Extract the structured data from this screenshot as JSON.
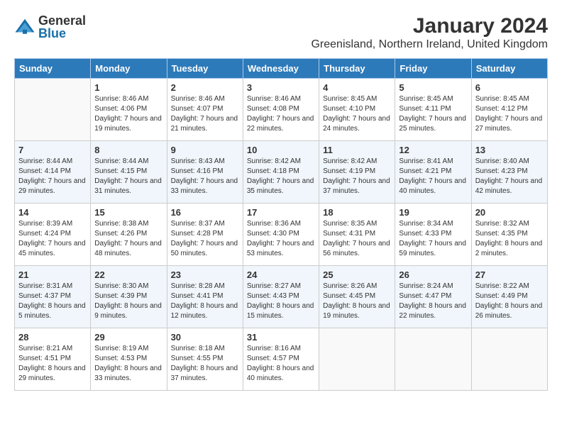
{
  "logo": {
    "text_general": "General",
    "text_blue": "Blue"
  },
  "title": "January 2024",
  "location": "Greenisland, Northern Ireland, United Kingdom",
  "days_of_week": [
    "Sunday",
    "Monday",
    "Tuesday",
    "Wednesday",
    "Thursday",
    "Friday",
    "Saturday"
  ],
  "weeks": [
    [
      {
        "day": "",
        "empty": true
      },
      {
        "day": "1",
        "sunrise": "Sunrise: 8:46 AM",
        "sunset": "Sunset: 4:06 PM",
        "daylight": "Daylight: 7 hours and 19 minutes."
      },
      {
        "day": "2",
        "sunrise": "Sunrise: 8:46 AM",
        "sunset": "Sunset: 4:07 PM",
        "daylight": "Daylight: 7 hours and 21 minutes."
      },
      {
        "day": "3",
        "sunrise": "Sunrise: 8:46 AM",
        "sunset": "Sunset: 4:08 PM",
        "daylight": "Daylight: 7 hours and 22 minutes."
      },
      {
        "day": "4",
        "sunrise": "Sunrise: 8:45 AM",
        "sunset": "Sunset: 4:10 PM",
        "daylight": "Daylight: 7 hours and 24 minutes."
      },
      {
        "day": "5",
        "sunrise": "Sunrise: 8:45 AM",
        "sunset": "Sunset: 4:11 PM",
        "daylight": "Daylight: 7 hours and 25 minutes."
      },
      {
        "day": "6",
        "sunrise": "Sunrise: 8:45 AM",
        "sunset": "Sunset: 4:12 PM",
        "daylight": "Daylight: 7 hours and 27 minutes."
      }
    ],
    [
      {
        "day": "7",
        "sunrise": "Sunrise: 8:44 AM",
        "sunset": "Sunset: 4:14 PM",
        "daylight": "Daylight: 7 hours and 29 minutes."
      },
      {
        "day": "8",
        "sunrise": "Sunrise: 8:44 AM",
        "sunset": "Sunset: 4:15 PM",
        "daylight": "Daylight: 7 hours and 31 minutes."
      },
      {
        "day": "9",
        "sunrise": "Sunrise: 8:43 AM",
        "sunset": "Sunset: 4:16 PM",
        "daylight": "Daylight: 7 hours and 33 minutes."
      },
      {
        "day": "10",
        "sunrise": "Sunrise: 8:42 AM",
        "sunset": "Sunset: 4:18 PM",
        "daylight": "Daylight: 7 hours and 35 minutes."
      },
      {
        "day": "11",
        "sunrise": "Sunrise: 8:42 AM",
        "sunset": "Sunset: 4:19 PM",
        "daylight": "Daylight: 7 hours and 37 minutes."
      },
      {
        "day": "12",
        "sunrise": "Sunrise: 8:41 AM",
        "sunset": "Sunset: 4:21 PM",
        "daylight": "Daylight: 7 hours and 40 minutes."
      },
      {
        "day": "13",
        "sunrise": "Sunrise: 8:40 AM",
        "sunset": "Sunset: 4:23 PM",
        "daylight": "Daylight: 7 hours and 42 minutes."
      }
    ],
    [
      {
        "day": "14",
        "sunrise": "Sunrise: 8:39 AM",
        "sunset": "Sunset: 4:24 PM",
        "daylight": "Daylight: 7 hours and 45 minutes."
      },
      {
        "day": "15",
        "sunrise": "Sunrise: 8:38 AM",
        "sunset": "Sunset: 4:26 PM",
        "daylight": "Daylight: 7 hours and 48 minutes."
      },
      {
        "day": "16",
        "sunrise": "Sunrise: 8:37 AM",
        "sunset": "Sunset: 4:28 PM",
        "daylight": "Daylight: 7 hours and 50 minutes."
      },
      {
        "day": "17",
        "sunrise": "Sunrise: 8:36 AM",
        "sunset": "Sunset: 4:30 PM",
        "daylight": "Daylight: 7 hours and 53 minutes."
      },
      {
        "day": "18",
        "sunrise": "Sunrise: 8:35 AM",
        "sunset": "Sunset: 4:31 PM",
        "daylight": "Daylight: 7 hours and 56 minutes."
      },
      {
        "day": "19",
        "sunrise": "Sunrise: 8:34 AM",
        "sunset": "Sunset: 4:33 PM",
        "daylight": "Daylight: 7 hours and 59 minutes."
      },
      {
        "day": "20",
        "sunrise": "Sunrise: 8:32 AM",
        "sunset": "Sunset: 4:35 PM",
        "daylight": "Daylight: 8 hours and 2 minutes."
      }
    ],
    [
      {
        "day": "21",
        "sunrise": "Sunrise: 8:31 AM",
        "sunset": "Sunset: 4:37 PM",
        "daylight": "Daylight: 8 hours and 5 minutes."
      },
      {
        "day": "22",
        "sunrise": "Sunrise: 8:30 AM",
        "sunset": "Sunset: 4:39 PM",
        "daylight": "Daylight: 8 hours and 9 minutes."
      },
      {
        "day": "23",
        "sunrise": "Sunrise: 8:28 AM",
        "sunset": "Sunset: 4:41 PM",
        "daylight": "Daylight: 8 hours and 12 minutes."
      },
      {
        "day": "24",
        "sunrise": "Sunrise: 8:27 AM",
        "sunset": "Sunset: 4:43 PM",
        "daylight": "Daylight: 8 hours and 15 minutes."
      },
      {
        "day": "25",
        "sunrise": "Sunrise: 8:26 AM",
        "sunset": "Sunset: 4:45 PM",
        "daylight": "Daylight: 8 hours and 19 minutes."
      },
      {
        "day": "26",
        "sunrise": "Sunrise: 8:24 AM",
        "sunset": "Sunset: 4:47 PM",
        "daylight": "Daylight: 8 hours and 22 minutes."
      },
      {
        "day": "27",
        "sunrise": "Sunrise: 8:22 AM",
        "sunset": "Sunset: 4:49 PM",
        "daylight": "Daylight: 8 hours and 26 minutes."
      }
    ],
    [
      {
        "day": "28",
        "sunrise": "Sunrise: 8:21 AM",
        "sunset": "Sunset: 4:51 PM",
        "daylight": "Daylight: 8 hours and 29 minutes."
      },
      {
        "day": "29",
        "sunrise": "Sunrise: 8:19 AM",
        "sunset": "Sunset: 4:53 PM",
        "daylight": "Daylight: 8 hours and 33 minutes."
      },
      {
        "day": "30",
        "sunrise": "Sunrise: 8:18 AM",
        "sunset": "Sunset: 4:55 PM",
        "daylight": "Daylight: 8 hours and 37 minutes."
      },
      {
        "day": "31",
        "sunrise": "Sunrise: 8:16 AM",
        "sunset": "Sunset: 4:57 PM",
        "daylight": "Daylight: 8 hours and 40 minutes."
      },
      {
        "day": "",
        "empty": true
      },
      {
        "day": "",
        "empty": true
      },
      {
        "day": "",
        "empty": true
      }
    ]
  ]
}
